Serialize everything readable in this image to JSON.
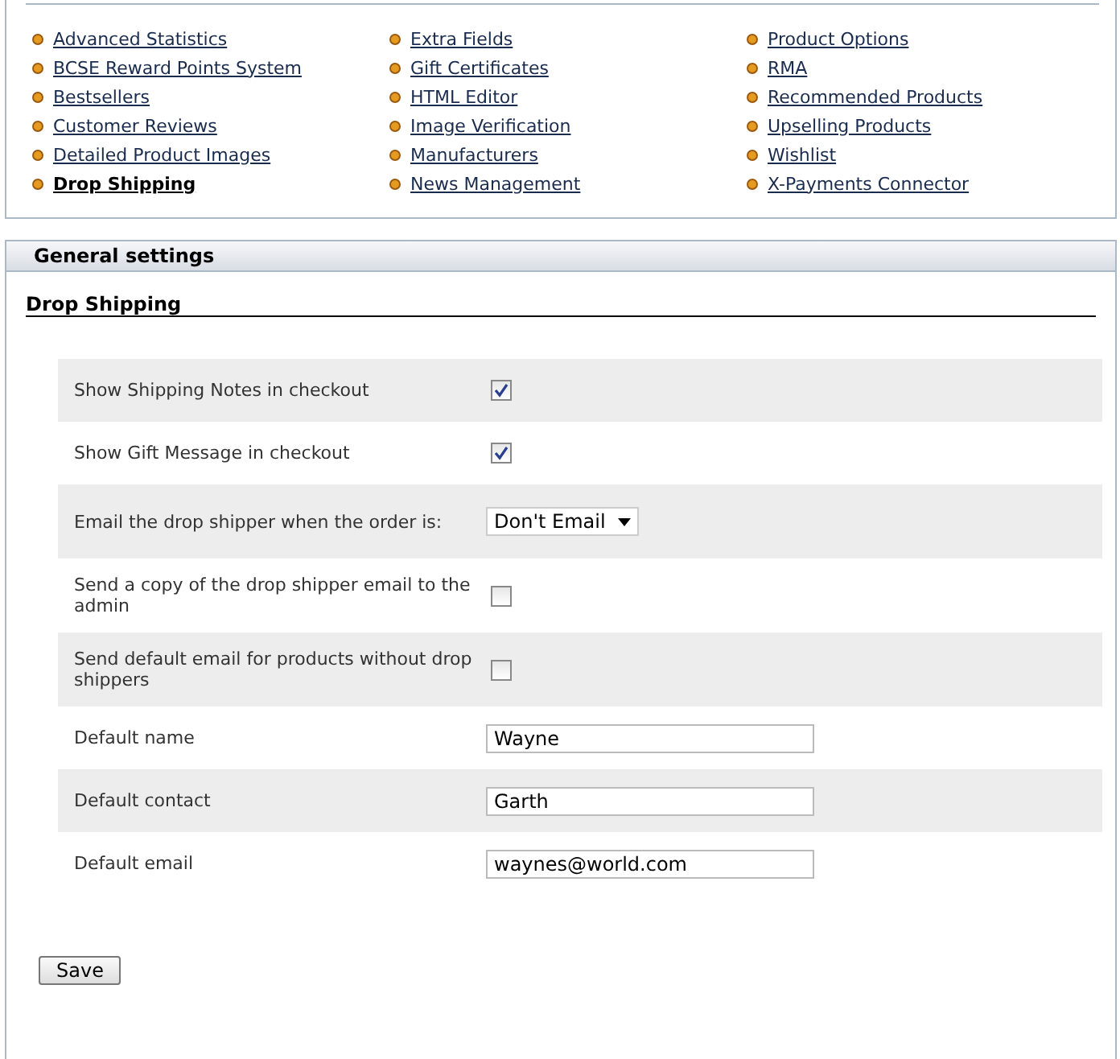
{
  "modules": {
    "columns": [
      [
        {
          "label": "Advanced Statistics",
          "selected": false
        },
        {
          "label": "BCSE Reward Points System",
          "selected": false
        },
        {
          "label": "Bestsellers",
          "selected": false
        },
        {
          "label": "Customer Reviews",
          "selected": false
        },
        {
          "label": "Detailed Product Images",
          "selected": false
        },
        {
          "label": "Drop Shipping",
          "selected": true
        }
      ],
      [
        {
          "label": "Extra Fields",
          "selected": false
        },
        {
          "label": "Gift Certificates",
          "selected": false
        },
        {
          "label": "HTML Editor",
          "selected": false
        },
        {
          "label": "Image Verification",
          "selected": false
        },
        {
          "label": "Manufacturers",
          "selected": false
        },
        {
          "label": "News Management",
          "selected": false
        }
      ],
      [
        {
          "label": "Product Options",
          "selected": false
        },
        {
          "label": "RMA",
          "selected": false
        },
        {
          "label": "Recommended Products",
          "selected": false
        },
        {
          "label": "Upselling Products",
          "selected": false
        },
        {
          "label": "Wishlist",
          "selected": false
        },
        {
          "label": "X-Payments Connector",
          "selected": false
        }
      ]
    ]
  },
  "panel": {
    "title": "General settings",
    "section": "Drop Shipping",
    "settings": [
      {
        "kind": "checkbox",
        "label": "Show Shipping Notes in checkout",
        "checked": true
      },
      {
        "kind": "checkbox",
        "label": "Show Gift Message in checkout",
        "checked": true
      },
      {
        "kind": "select",
        "label": "Email the drop shipper when the order is:",
        "value": "Don't Email"
      },
      {
        "kind": "checkbox",
        "label": "Send a copy of the drop shipper email to the admin",
        "checked": false
      },
      {
        "kind": "checkbox",
        "label": "Send default email for products without drop shippers",
        "checked": false
      },
      {
        "kind": "text",
        "label": "Default name",
        "value": "Wayne"
      },
      {
        "kind": "text",
        "label": "Default contact",
        "value": "Garth"
      },
      {
        "kind": "text",
        "label": "Default email",
        "value": "waynes@world.com"
      }
    ],
    "save_button": "Save"
  }
}
